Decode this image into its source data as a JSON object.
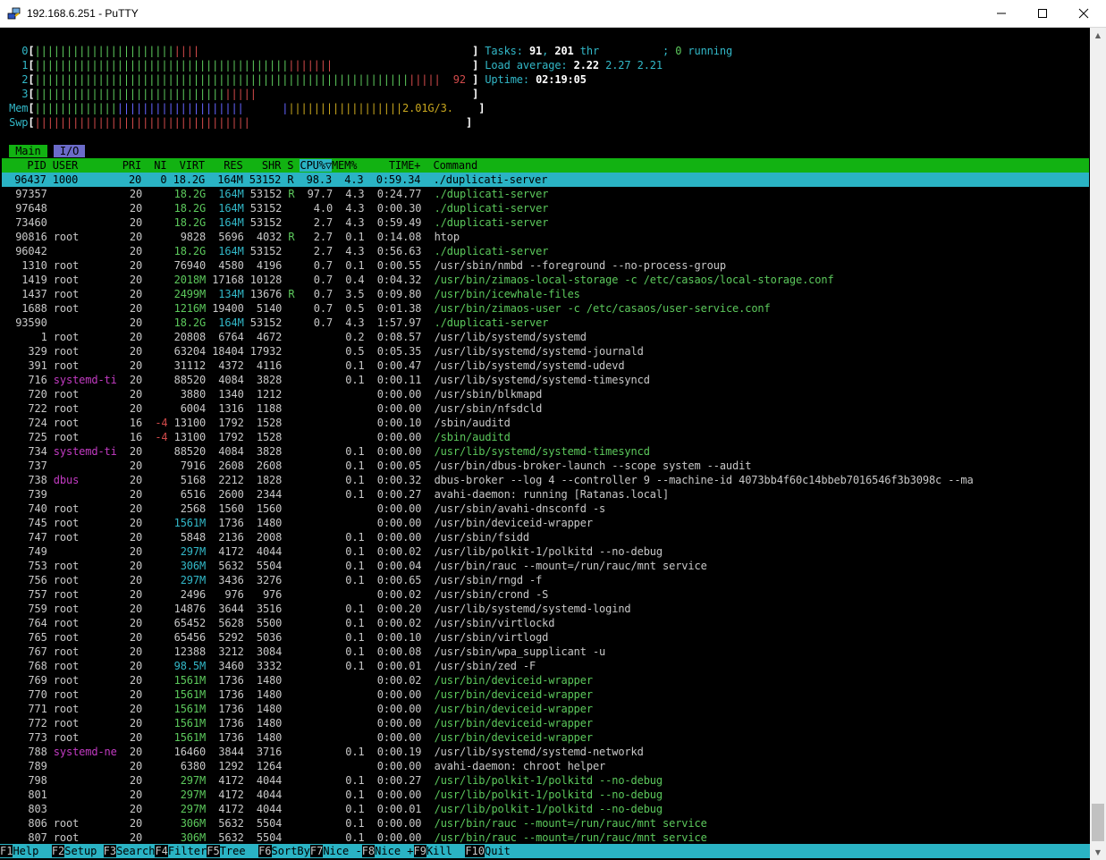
{
  "window": {
    "title": "192.168.6.251 - PuTTY",
    "icon": "putty-icon"
  },
  "header": {
    "cpu": [
      {
        "label": "0",
        "value": ""
      },
      {
        "label": "1",
        "value": ""
      },
      {
        "label": "2",
        "value": "92"
      },
      {
        "label": "3",
        "value": ""
      }
    ],
    "mem": {
      "label": "Mem",
      "value": "2.01G/3."
    },
    "swp": {
      "label": "Swp",
      "value": ""
    },
    "tasks": {
      "label": "Tasks: ",
      "tasks": "91",
      "thr": "201",
      "thr_label": " thr",
      "running": "0",
      "running_label": " running"
    },
    "load": {
      "label": "Load average: ",
      "l1": "2.22",
      "l5": "2.27",
      "l15": "2.21"
    },
    "uptime": {
      "label": "Uptime: ",
      "value": "02:19:05"
    }
  },
  "tabs": [
    "Main",
    "I/O"
  ],
  "columns": [
    "PID",
    "USER",
    "PRI",
    "NI",
    "VIRT",
    "RES",
    "SHR",
    "S",
    "CPU%",
    "MEM%",
    "TIME+",
    "Command"
  ],
  "processes": [
    {
      "pid": "96437",
      "user": "1000",
      "pri": "20",
      "ni": "0",
      "virt": "18.2G",
      "res": "164M",
      "shr": "53152",
      "s": "R",
      "cpu": "98.3",
      "mem": "4.3",
      "time": "0:59.34",
      "cmd": "./duplicati-server",
      "sel": true
    },
    {
      "pid": "97357",
      "user": "",
      "pri": "20",
      "ni": "",
      "virt": "18.2G",
      "res": "164M",
      "shr": "53152",
      "s": "R",
      "cpu": "97.7",
      "mem": "4.3",
      "time": "0:24.77",
      "cmd": "./duplicati-server",
      "thread": true
    },
    {
      "pid": "97648",
      "user": "",
      "pri": "20",
      "ni": "",
      "virt": "18.2G",
      "res": "164M",
      "shr": "53152",
      "s": "",
      "cpu": "4.0",
      "mem": "4.3",
      "time": "0:00.30",
      "cmd": "./duplicati-server",
      "thread": true
    },
    {
      "pid": "73460",
      "user": "",
      "pri": "20",
      "ni": "",
      "virt": "18.2G",
      "res": "164M",
      "shr": "53152",
      "s": "",
      "cpu": "2.7",
      "mem": "4.3",
      "time": "0:59.49",
      "cmd": "./duplicati-server",
      "thread": true
    },
    {
      "pid": "90816",
      "user": "root",
      "pri": "20",
      "ni": "",
      "virt": "9828",
      "res": "5696",
      "shr": "4032",
      "s": "R",
      "cpu": "2.7",
      "mem": "0.1",
      "time": "0:14.08",
      "cmd": "htop"
    },
    {
      "pid": "96042",
      "user": "",
      "pri": "20",
      "ni": "",
      "virt": "18.2G",
      "res": "164M",
      "shr": "53152",
      "s": "",
      "cpu": "2.7",
      "mem": "4.3",
      "time": "0:56.63",
      "cmd": "./duplicati-server",
      "thread": true
    },
    {
      "pid": "1310",
      "user": "root",
      "pri": "20",
      "ni": "",
      "virt": "76940",
      "res": "4580",
      "shr": "4196",
      "s": "",
      "cpu": "0.7",
      "mem": "0.1",
      "time": "0:00.55",
      "cmd": "/usr/sbin/nmbd --foreground --no-process-group"
    },
    {
      "pid": "1419",
      "user": "root",
      "pri": "20",
      "ni": "",
      "virt": "2018M",
      "res": "17168",
      "shr": "10128",
      "s": "",
      "cpu": "0.7",
      "mem": "0.4",
      "time": "0:04.32",
      "cmd": "/usr/bin/zimaos-local-storage -c /etc/casaos/local-storage.conf",
      "thread": true
    },
    {
      "pid": "1437",
      "user": "root",
      "pri": "20",
      "ni": "",
      "virt": "2499M",
      "res": "134M",
      "shr": "13676",
      "s": "R",
      "cpu": "0.7",
      "mem": "3.5",
      "time": "0:09.80",
      "cmd": "/usr/bin/icewhale-files",
      "thread": true
    },
    {
      "pid": "1688",
      "user": "root",
      "pri": "20",
      "ni": "",
      "virt": "1216M",
      "res": "19400",
      "shr": "5140",
      "s": "",
      "cpu": "0.7",
      "mem": "0.5",
      "time": "0:01.38",
      "cmd": "/usr/bin/zimaos-user -c /etc/casaos/user-service.conf",
      "thread": true
    },
    {
      "pid": "93590",
      "user": "",
      "pri": "20",
      "ni": "",
      "virt": "18.2G",
      "res": "164M",
      "shr": "53152",
      "s": "",
      "cpu": "0.7",
      "mem": "4.3",
      "time": "1:57.97",
      "cmd": "./duplicati-server",
      "thread": true
    },
    {
      "pid": "1",
      "user": "root",
      "pri": "20",
      "ni": "",
      "virt": "20808",
      "res": "6764",
      "shr": "4672",
      "s": "",
      "cpu": "",
      "mem": "0.2",
      "time": "0:08.57",
      "cmd": "/usr/lib/systemd/systemd"
    },
    {
      "pid": "329",
      "user": "root",
      "pri": "20",
      "ni": "",
      "virt": "63204",
      "res": "18404",
      "shr": "17932",
      "s": "",
      "cpu": "",
      "mem": "0.5",
      "time": "0:05.35",
      "cmd": "/usr/lib/systemd/systemd-journald"
    },
    {
      "pid": "391",
      "user": "root",
      "pri": "20",
      "ni": "",
      "virt": "31112",
      "res": "4372",
      "shr": "4116",
      "s": "",
      "cpu": "",
      "mem": "0.1",
      "time": "0:00.47",
      "cmd": "/usr/lib/systemd/systemd-udevd"
    },
    {
      "pid": "716",
      "user": "systemd-ti",
      "pri": "20",
      "ni": "",
      "virt": "88520",
      "res": "4084",
      "shr": "3828",
      "s": "",
      "cpu": "",
      "mem": "0.1",
      "time": "0:00.11",
      "cmd": "/usr/lib/systemd/systemd-timesyncd",
      "ucol": "m"
    },
    {
      "pid": "720",
      "user": "root",
      "pri": "20",
      "ni": "",
      "virt": "3880",
      "res": "1340",
      "shr": "1212",
      "s": "",
      "cpu": "",
      "mem": "",
      "time": "0:00.00",
      "cmd": "/usr/sbin/blkmapd"
    },
    {
      "pid": "722",
      "user": "root",
      "pri": "20",
      "ni": "",
      "virt": "6004",
      "res": "1316",
      "shr": "1188",
      "s": "",
      "cpu": "",
      "mem": "",
      "time": "0:00.00",
      "cmd": "/usr/sbin/nfsdcld"
    },
    {
      "pid": "724",
      "user": "root",
      "pri": "16",
      "ni": "-4",
      "virt": "13100",
      "res": "1792",
      "shr": "1528",
      "s": "",
      "cpu": "",
      "mem": "",
      "time": "0:00.10",
      "cmd": "/sbin/auditd"
    },
    {
      "pid": "725",
      "user": "root",
      "pri": "16",
      "ni": "-4",
      "virt": "13100",
      "res": "1792",
      "shr": "1528",
      "s": "",
      "cpu": "",
      "mem": "",
      "time": "0:00.00",
      "cmd": "/sbin/auditd",
      "thread": true
    },
    {
      "pid": "734",
      "user": "systemd-ti",
      "pri": "20",
      "ni": "",
      "virt": "88520",
      "res": "4084",
      "shr": "3828",
      "s": "",
      "cpu": "",
      "mem": "0.1",
      "time": "0:00.00",
      "cmd": "/usr/lib/systemd/systemd-timesyncd",
      "ucol": "m",
      "thread": true
    },
    {
      "pid": "737",
      "user": "",
      "pri": "20",
      "ni": "",
      "virt": "7916",
      "res": "2608",
      "shr": "2608",
      "s": "",
      "cpu": "",
      "mem": "0.1",
      "time": "0:00.05",
      "cmd": "/usr/bin/dbus-broker-launch --scope system --audit"
    },
    {
      "pid": "738",
      "user": "dbus",
      "pri": "20",
      "ni": "",
      "virt": "5168",
      "res": "2212",
      "shr": "1828",
      "s": "",
      "cpu": "",
      "mem": "0.1",
      "time": "0:00.32",
      "cmd": "dbus-broker --log 4 --controller 9 --machine-id 4073bb4f60c14bbeb7016546f3b3098c --ma",
      "ucol": "m"
    },
    {
      "pid": "739",
      "user": "",
      "pri": "20",
      "ni": "",
      "virt": "6516",
      "res": "2600",
      "shr": "2344",
      "s": "",
      "cpu": "",
      "mem": "0.1",
      "time": "0:00.27",
      "cmd": "avahi-daemon: running [Ratanas.local]"
    },
    {
      "pid": "740",
      "user": "root",
      "pri": "20",
      "ni": "",
      "virt": "2568",
      "res": "1560",
      "shr": "1560",
      "s": "",
      "cpu": "",
      "mem": "",
      "time": "0:00.00",
      "cmd": "/usr/sbin/avahi-dnsconfd -s"
    },
    {
      "pid": "745",
      "user": "root",
      "pri": "20",
      "ni": "",
      "virt": "1561M",
      "res": "1736",
      "shr": "1480",
      "s": "",
      "cpu": "",
      "mem": "",
      "time": "0:00.00",
      "cmd": "/usr/bin/deviceid-wrapper"
    },
    {
      "pid": "747",
      "user": "root",
      "pri": "20",
      "ni": "",
      "virt": "5848",
      "res": "2136",
      "shr": "2008",
      "s": "",
      "cpu": "",
      "mem": "0.1",
      "time": "0:00.00",
      "cmd": "/usr/sbin/fsidd"
    },
    {
      "pid": "749",
      "user": "",
      "pri": "20",
      "ni": "",
      "virt": "297M",
      "res": "4172",
      "shr": "4044",
      "s": "",
      "cpu": "",
      "mem": "0.1",
      "time": "0:00.02",
      "cmd": "/usr/lib/polkit-1/polkitd --no-debug"
    },
    {
      "pid": "753",
      "user": "root",
      "pri": "20",
      "ni": "",
      "virt": "306M",
      "res": "5632",
      "shr": "5504",
      "s": "",
      "cpu": "",
      "mem": "0.1",
      "time": "0:00.04",
      "cmd": "/usr/bin/rauc --mount=/run/rauc/mnt service"
    },
    {
      "pid": "756",
      "user": "root",
      "pri": "20",
      "ni": "",
      "virt": "297M",
      "res": "3436",
      "shr": "3276",
      "s": "",
      "cpu": "",
      "mem": "0.1",
      "time": "0:00.65",
      "cmd": "/usr/sbin/rngd -f"
    },
    {
      "pid": "757",
      "user": "root",
      "pri": "20",
      "ni": "",
      "virt": "2496",
      "res": "976",
      "shr": "976",
      "s": "",
      "cpu": "",
      "mem": "",
      "time": "0:00.02",
      "cmd": "/usr/sbin/crond -S"
    },
    {
      "pid": "759",
      "user": "root",
      "pri": "20",
      "ni": "",
      "virt": "14876",
      "res": "3644",
      "shr": "3516",
      "s": "",
      "cpu": "",
      "mem": "0.1",
      "time": "0:00.20",
      "cmd": "/usr/lib/systemd/systemd-logind"
    },
    {
      "pid": "764",
      "user": "root",
      "pri": "20",
      "ni": "",
      "virt": "65452",
      "res": "5628",
      "shr": "5500",
      "s": "",
      "cpu": "",
      "mem": "0.1",
      "time": "0:00.02",
      "cmd": "/usr/sbin/virtlockd"
    },
    {
      "pid": "765",
      "user": "root",
      "pri": "20",
      "ni": "",
      "virt": "65456",
      "res": "5292",
      "shr": "5036",
      "s": "",
      "cpu": "",
      "mem": "0.1",
      "time": "0:00.10",
      "cmd": "/usr/sbin/virtlogd"
    },
    {
      "pid": "767",
      "user": "root",
      "pri": "20",
      "ni": "",
      "virt": "12388",
      "res": "3212",
      "shr": "3084",
      "s": "",
      "cpu": "",
      "mem": "0.1",
      "time": "0:00.08",
      "cmd": "/usr/sbin/wpa_supplicant -u"
    },
    {
      "pid": "768",
      "user": "root",
      "pri": "20",
      "ni": "",
      "virt": "98.5M",
      "res": "3460",
      "shr": "3332",
      "s": "",
      "cpu": "",
      "mem": "0.1",
      "time": "0:00.01",
      "cmd": "/usr/sbin/zed -F"
    },
    {
      "pid": "769",
      "user": "root",
      "pri": "20",
      "ni": "",
      "virt": "1561M",
      "res": "1736",
      "shr": "1480",
      "s": "",
      "cpu": "",
      "mem": "",
      "time": "0:00.02",
      "cmd": "/usr/bin/deviceid-wrapper",
      "thread": true
    },
    {
      "pid": "770",
      "user": "root",
      "pri": "20",
      "ni": "",
      "virt": "1561M",
      "res": "1736",
      "shr": "1480",
      "s": "",
      "cpu": "",
      "mem": "",
      "time": "0:00.00",
      "cmd": "/usr/bin/deviceid-wrapper",
      "thread": true
    },
    {
      "pid": "771",
      "user": "root",
      "pri": "20",
      "ni": "",
      "virt": "1561M",
      "res": "1736",
      "shr": "1480",
      "s": "",
      "cpu": "",
      "mem": "",
      "time": "0:00.00",
      "cmd": "/usr/bin/deviceid-wrapper",
      "thread": true
    },
    {
      "pid": "772",
      "user": "root",
      "pri": "20",
      "ni": "",
      "virt": "1561M",
      "res": "1736",
      "shr": "1480",
      "s": "",
      "cpu": "",
      "mem": "",
      "time": "0:00.00",
      "cmd": "/usr/bin/deviceid-wrapper",
      "thread": true
    },
    {
      "pid": "773",
      "user": "root",
      "pri": "20",
      "ni": "",
      "virt": "1561M",
      "res": "1736",
      "shr": "1480",
      "s": "",
      "cpu": "",
      "mem": "",
      "time": "0:00.00",
      "cmd": "/usr/bin/deviceid-wrapper",
      "thread": true
    },
    {
      "pid": "788",
      "user": "systemd-ne",
      "pri": "20",
      "ni": "",
      "virt": "16460",
      "res": "3844",
      "shr": "3716",
      "s": "",
      "cpu": "",
      "mem": "0.1",
      "time": "0:00.19",
      "cmd": "/usr/lib/systemd/systemd-networkd",
      "ucol": "m"
    },
    {
      "pid": "789",
      "user": "",
      "pri": "20",
      "ni": "",
      "virt": "6380",
      "res": "1292",
      "shr": "1264",
      "s": "",
      "cpu": "",
      "mem": "",
      "time": "0:00.00",
      "cmd": "avahi-daemon: chroot helper"
    },
    {
      "pid": "798",
      "user": "",
      "pri": "20",
      "ni": "",
      "virt": "297M",
      "res": "4172",
      "shr": "4044",
      "s": "",
      "cpu": "",
      "mem": "0.1",
      "time": "0:00.27",
      "cmd": "/usr/lib/polkit-1/polkitd --no-debug",
      "thread": true
    },
    {
      "pid": "801",
      "user": "",
      "pri": "20",
      "ni": "",
      "virt": "297M",
      "res": "4172",
      "shr": "4044",
      "s": "",
      "cpu": "",
      "mem": "0.1",
      "time": "0:00.00",
      "cmd": "/usr/lib/polkit-1/polkitd --no-debug",
      "thread": true
    },
    {
      "pid": "803",
      "user": "",
      "pri": "20",
      "ni": "",
      "virt": "297M",
      "res": "4172",
      "shr": "4044",
      "s": "",
      "cpu": "",
      "mem": "0.1",
      "time": "0:00.01",
      "cmd": "/usr/lib/polkit-1/polkitd --no-debug",
      "thread": true
    },
    {
      "pid": "806",
      "user": "root",
      "pri": "20",
      "ni": "",
      "virt": "306M",
      "res": "5632",
      "shr": "5504",
      "s": "",
      "cpu": "",
      "mem": "0.1",
      "time": "0:00.00",
      "cmd": "/usr/bin/rauc --mount=/run/rauc/mnt service",
      "thread": true
    },
    {
      "pid": "807",
      "user": "root",
      "pri": "20",
      "ni": "",
      "virt": "306M",
      "res": "5632",
      "shr": "5504",
      "s": "",
      "cpu": "",
      "mem": "0.1",
      "time": "0:00.00",
      "cmd": "/usr/bin/rauc --mount=/run/rauc/mnt service",
      "thread": true
    }
  ],
  "fkeys": [
    {
      "key": "F1",
      "label": "Help  "
    },
    {
      "key": "F2",
      "label": "Setup "
    },
    {
      "key": "F3",
      "label": "Search"
    },
    {
      "key": "F4",
      "label": "Filter"
    },
    {
      "key": "F5",
      "label": "Tree  "
    },
    {
      "key": "F6",
      "label": "SortBy"
    },
    {
      "key": "F7",
      "label": "Nice -"
    },
    {
      "key": "F8",
      "label": "Nice +"
    },
    {
      "key": "F9",
      "label": "Kill  "
    },
    {
      "key": "F10",
      "label": "Quit"
    }
  ],
  "colors": {
    "green": "#5cc95c",
    "cyan": "#2ab3c4",
    "magenta": "#c33bc3",
    "red": "#d14a4a",
    "blue": "#6464ff",
    "yellow": "#c9a71e"
  }
}
